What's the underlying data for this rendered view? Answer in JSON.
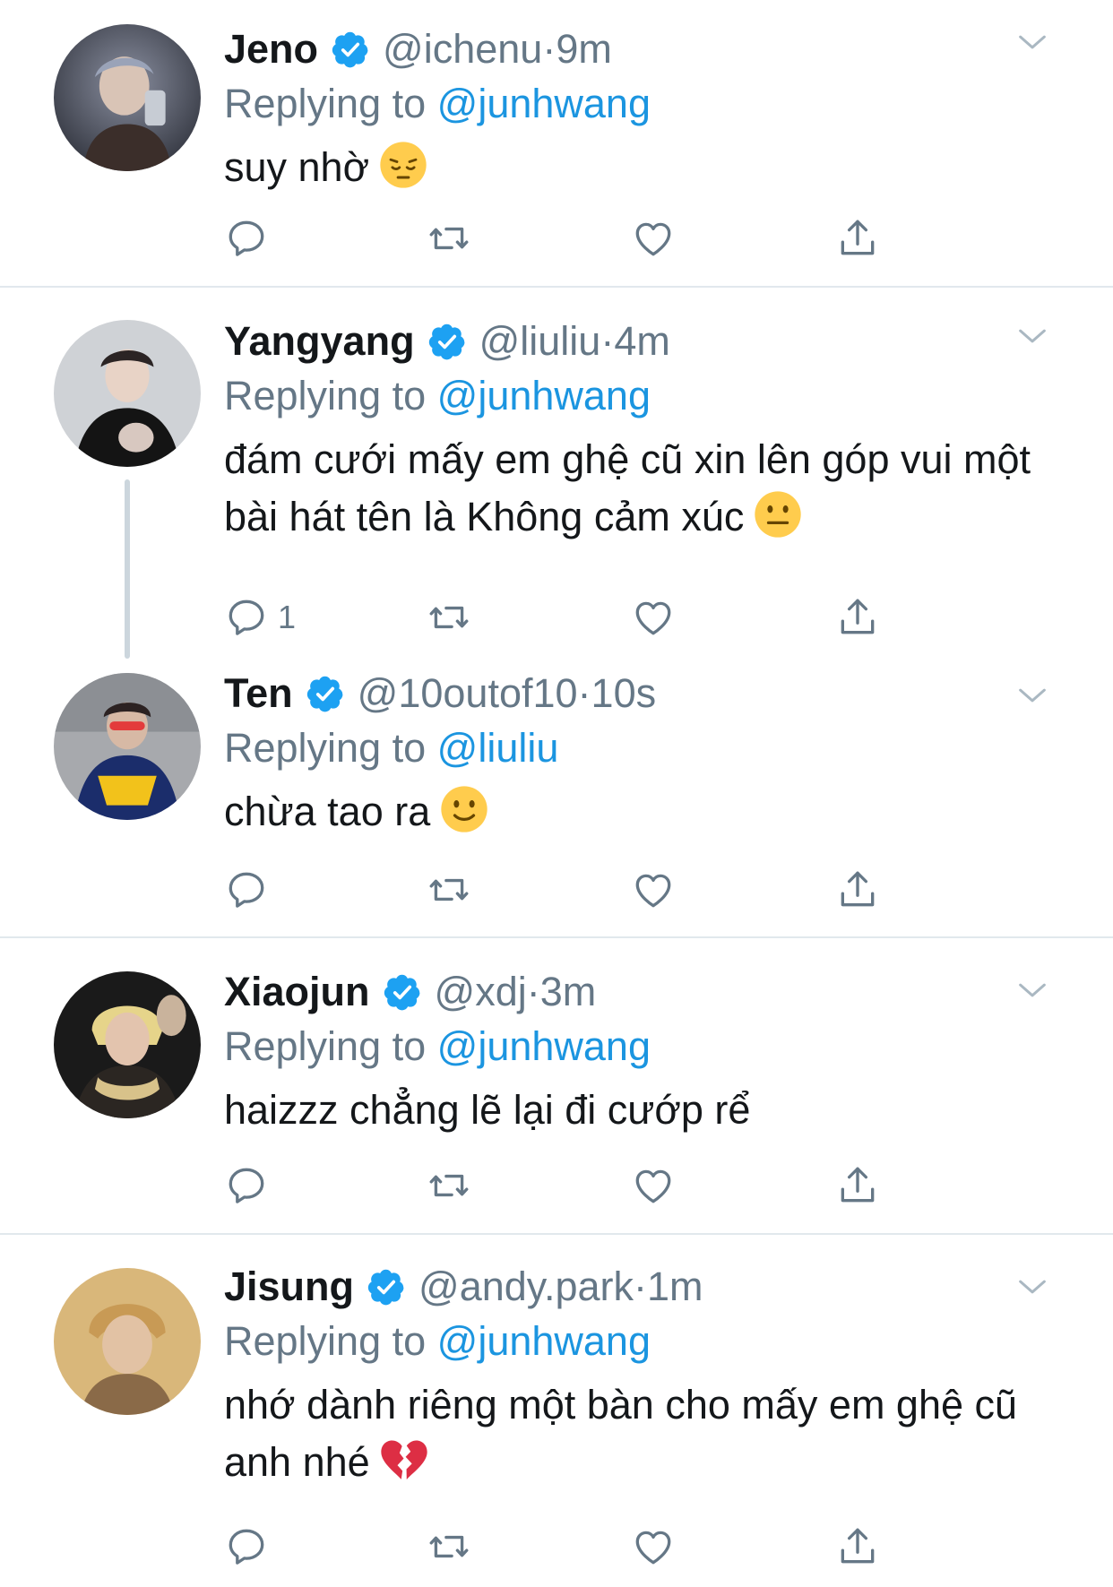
{
  "tweets": [
    {
      "name": "Jeno",
      "handle": "@ichenu",
      "time": "9m",
      "replying_prefix": "Replying to ",
      "replying_to": "@junhwang",
      "text": "suy nhờ",
      "emoji": "pensive-face-emoji",
      "reply_count": ""
    },
    {
      "name": "Yangyang",
      "handle": "@liuliu",
      "time": "4m",
      "replying_prefix": "Replying to ",
      "replying_to": "@junhwang",
      "text": "đám cưới mấy em ghệ cũ xin lên góp vui một bài hát tên là Không cảm xúc",
      "emoji": "neutral-face-emoji",
      "reply_count": "1"
    },
    {
      "name": "Ten",
      "handle": "@10outof10",
      "time": "10s",
      "replying_prefix": "Replying to ",
      "replying_to": "@liuliu",
      "text": "chừa tao ra",
      "emoji": "slightly-smiling-face-emoji",
      "reply_count": ""
    },
    {
      "name": "Xiaojun",
      "handle": "@xdj",
      "time": "3m",
      "replying_prefix": "Replying to ",
      "replying_to": "@junhwang",
      "text": "haizzz chẳng lẽ lại đi cướp rể",
      "emoji": "",
      "reply_count": ""
    },
    {
      "name": "Jisung",
      "handle": "@andy.park",
      "time": "1m",
      "replying_prefix": "Replying to ",
      "replying_to": "@junhwang",
      "text": "nhớ dành riêng một bàn cho mấy em ghệ cũ anh nhé",
      "emoji": "broken-heart-emoji",
      "reply_count": ""
    }
  ],
  "separator": " · ",
  "colors": {
    "link": "#1b95e0",
    "secondary": "#657786",
    "verified": "#1da1f2",
    "divider": "#e1e8ed"
  },
  "icons": [
    "reply-icon",
    "retweet-icon",
    "like-icon",
    "share-icon",
    "chevron-down-icon",
    "verified-badge-icon"
  ]
}
